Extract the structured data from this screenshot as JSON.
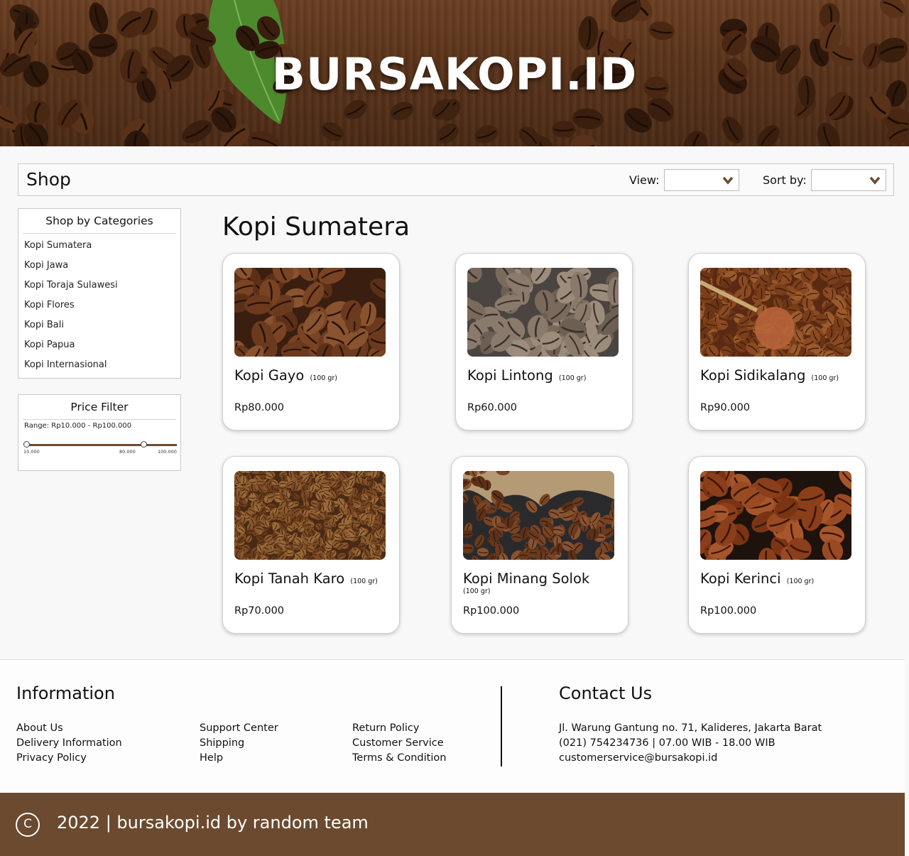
{
  "hero": {
    "title": "BURSAKOPI.ID"
  },
  "shop_bar": {
    "title": "Shop",
    "view_label": "View:",
    "sort_label": "Sort by:"
  },
  "sidebar": {
    "categories_title": "Shop by Categories",
    "categories": [
      "Kopi Sumatera",
      "Kopi Jawa",
      "Kopi Toraja Sulawesi",
      "Kopi Flores",
      "Kopi Bali",
      "Kopi Papua",
      "Kopi Internasional"
    ],
    "price_filter": {
      "title": "Price Filter",
      "range_text": "Range: Rp10.000 - Rp100.000",
      "min": 10000,
      "max": 100000,
      "selected": 80000,
      "ticks": [
        "10.000",
        "80.000",
        "100.000"
      ]
    }
  },
  "main": {
    "heading": "Kopi Sumatera",
    "products": [
      {
        "name": "Kopi Gayo",
        "unit": "(100 gr)",
        "price": "Rp80.000",
        "image": "coffee-beans-medium-roast"
      },
      {
        "name": "Kopi Lintong",
        "unit": "(100 gr)",
        "price": "Rp60.000",
        "image": "coffee-beans-light-roast"
      },
      {
        "name": "Kopi Sidikalang",
        "unit": "(100 gr)",
        "price": "Rp90.000",
        "image": "coffee-beans-with-copper-cup"
      },
      {
        "name": "Kopi Tanah Karo",
        "unit": "(100 gr)",
        "price": "Rp70.000",
        "image": "coffee-beans-fine-pile"
      },
      {
        "name": "Kopi Minang Solok",
        "unit": "(100 gr)",
        "price": "Rp100.000",
        "image": "coffee-beans-in-burlap-sack"
      },
      {
        "name": "Kopi Kerinci",
        "unit": "(100 gr)",
        "price": "Rp100.000",
        "image": "coffee-beans-dark-roast"
      }
    ]
  },
  "footer": {
    "info_title": "Information",
    "info_col1": [
      "About Us",
      "Delivery Information",
      "Privacy Policy"
    ],
    "info_col2": [
      "Support Center",
      "Shipping",
      "Help"
    ],
    "info_col3": [
      "Return Policy",
      "Customer Service",
      "Terms & Condition"
    ],
    "contact_title": "Contact Us",
    "contact_lines": [
      "Jl. Warung Gantung no. 71, Kalideres, Jakarta Barat",
      "(021) 754234736 | 07.00 WIB - 18.00 WIB",
      "customerservice@bursakopi.id"
    ],
    "copyright_symbol": "C",
    "copyright": "2022 | bursakopi.id by random team"
  },
  "colors": {
    "brand_brown": "#6b4a2f",
    "hero_wood": "#5b341b"
  },
  "icons": {
    "dropdown": "chevron-down-icon",
    "copyright": "copyright-icon",
    "leaf": "coffee-leaf-icon"
  }
}
